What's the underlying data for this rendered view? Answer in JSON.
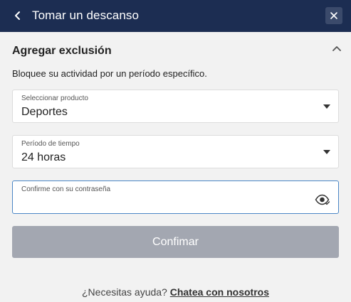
{
  "header": {
    "title": "Tomar un descanso",
    "back_icon": "chevron-left-icon",
    "close_icon": "close-icon"
  },
  "section": {
    "title": "Agregar exclusión",
    "collapse_icon": "chevron-up-icon",
    "description": "Bloquee su actividad por un período específico."
  },
  "product_select": {
    "label": "Seleccionar producto",
    "value": "Deportes"
  },
  "period_select": {
    "label": "Período de tiempo",
    "value": "24 horas"
  },
  "password_field": {
    "label": "Confirme con su contraseña",
    "value": "",
    "toggle_icon": "eye-icon"
  },
  "confirm_button": {
    "label": "Confimar"
  },
  "help": {
    "text": "¿Necesitas ayuda?",
    "link": "Chatea con nosotros"
  },
  "colors": {
    "header_bg": "#1c2d52",
    "page_bg": "#f2f2f2",
    "button_disabled": "#a3a7b1",
    "focus_border": "#4a86c5"
  }
}
